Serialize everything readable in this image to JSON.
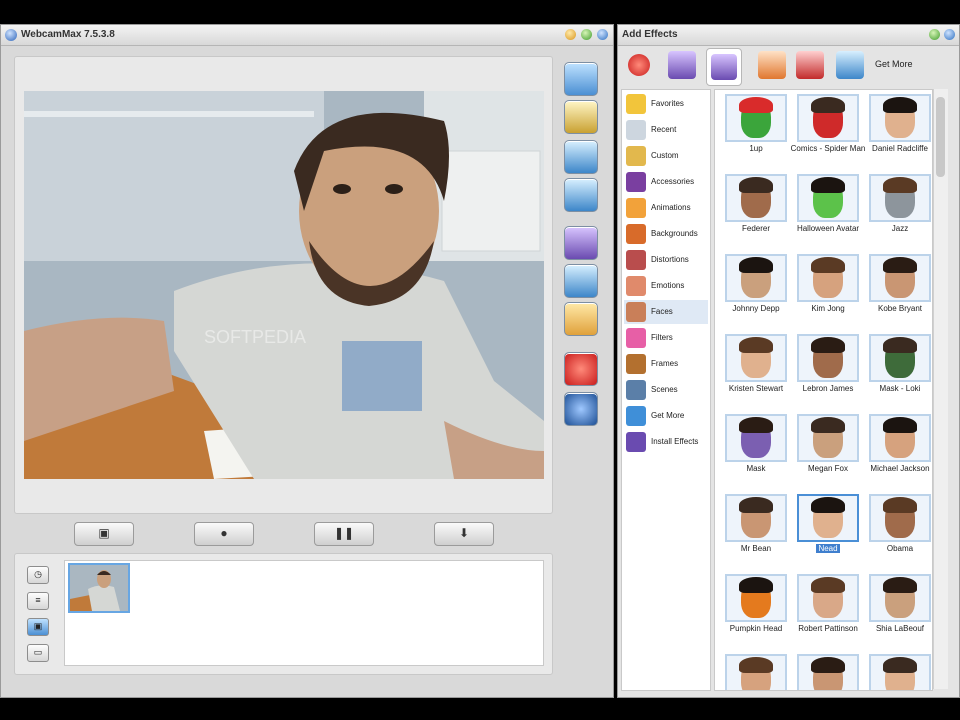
{
  "main_window": {
    "title": "WebcamMax  7.5.3.8",
    "video": {
      "watermark": "SOFTPEDIA"
    },
    "toolbar": [
      "effects-icon",
      "clapper-icon",
      "window-icon",
      "picture-in-picture-icon",
      "magic-hat-icon",
      "paint-icon",
      "add-effect-icon",
      "stop-icon",
      "settings-icon"
    ],
    "controls": {
      "snapshot": "▣",
      "record": "●",
      "pause": "❚❚",
      "download": "⬇"
    },
    "gallery_tabs": [
      "clock-icon",
      "list-icon",
      "video-icon",
      "image-icon"
    ]
  },
  "effects_window": {
    "title": "Add Effects",
    "get_more": "Get More",
    "categories": [
      {
        "label": "Favorites",
        "color": "#f2c53b"
      },
      {
        "label": "Recent",
        "color": "#cdd6df"
      },
      {
        "label": "Custom",
        "color": "#e2b84d"
      },
      {
        "label": "Accessories",
        "color": "#7a3fa0"
      },
      {
        "label": "Animations",
        "color": "#f2a23a"
      },
      {
        "label": "Backgrounds",
        "color": "#d86b2a"
      },
      {
        "label": "Distortions",
        "color": "#b94d4d"
      },
      {
        "label": "Emotions",
        "color": "#e08a6b"
      },
      {
        "label": "Faces",
        "color": "#c97f59"
      },
      {
        "label": "Filters",
        "color": "#e75fa6"
      },
      {
        "label": "Frames",
        "color": "#b3702f"
      },
      {
        "label": "Scenes",
        "color": "#5b7fa8"
      },
      {
        "label": "Get More",
        "color": "#3f8fd8"
      },
      {
        "label": "Install Effects",
        "color": "#6a4bb0"
      }
    ],
    "selected_category": "Faces",
    "effects": [
      [
        "1up",
        "Comics - Spider Man",
        "Daniel Radcliffe"
      ],
      [
        "Federer",
        "Halloween Avatar",
        "Jazz"
      ],
      [
        "Johnny Depp",
        "Kim Jong",
        "Kobe Bryant"
      ],
      [
        "Kristen Stewart",
        "Lebron James",
        "Mask - Loki"
      ],
      [
        "Mask",
        "Megan Fox",
        "Michael Jackson"
      ],
      [
        "Mr Bean",
        "Nead",
        "Obama"
      ],
      [
        "Pumpkin Head",
        "Robert Pattinson",
        "Shia LaBeouf"
      ],
      [
        "",
        "",
        ""
      ]
    ],
    "selected_effect": "Nead",
    "accent": "#3f7fce"
  }
}
